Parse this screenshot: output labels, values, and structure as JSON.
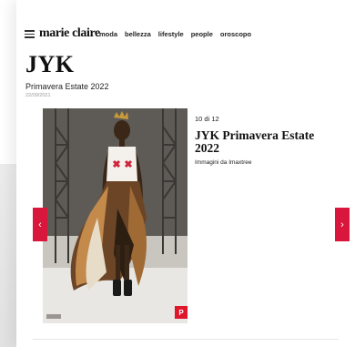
{
  "header": {
    "logo": "marie claire",
    "menu_icon": "hamburger-icon",
    "nav": [
      "moda",
      "bellezza",
      "lifestyle",
      "people",
      "oroscopo"
    ]
  },
  "article": {
    "title": "JYK",
    "subtitle": "Primavera Estate 2022",
    "date": "22/09/2021"
  },
  "gallery": {
    "counter": "10 di 12",
    "slide_title": "JYK Primavera Estate 2022",
    "credit": "Immagini da Imaxtree",
    "pin_label": "P",
    "prev_label": "‹",
    "next_label": "›",
    "accent_color": "#d9163b"
  }
}
